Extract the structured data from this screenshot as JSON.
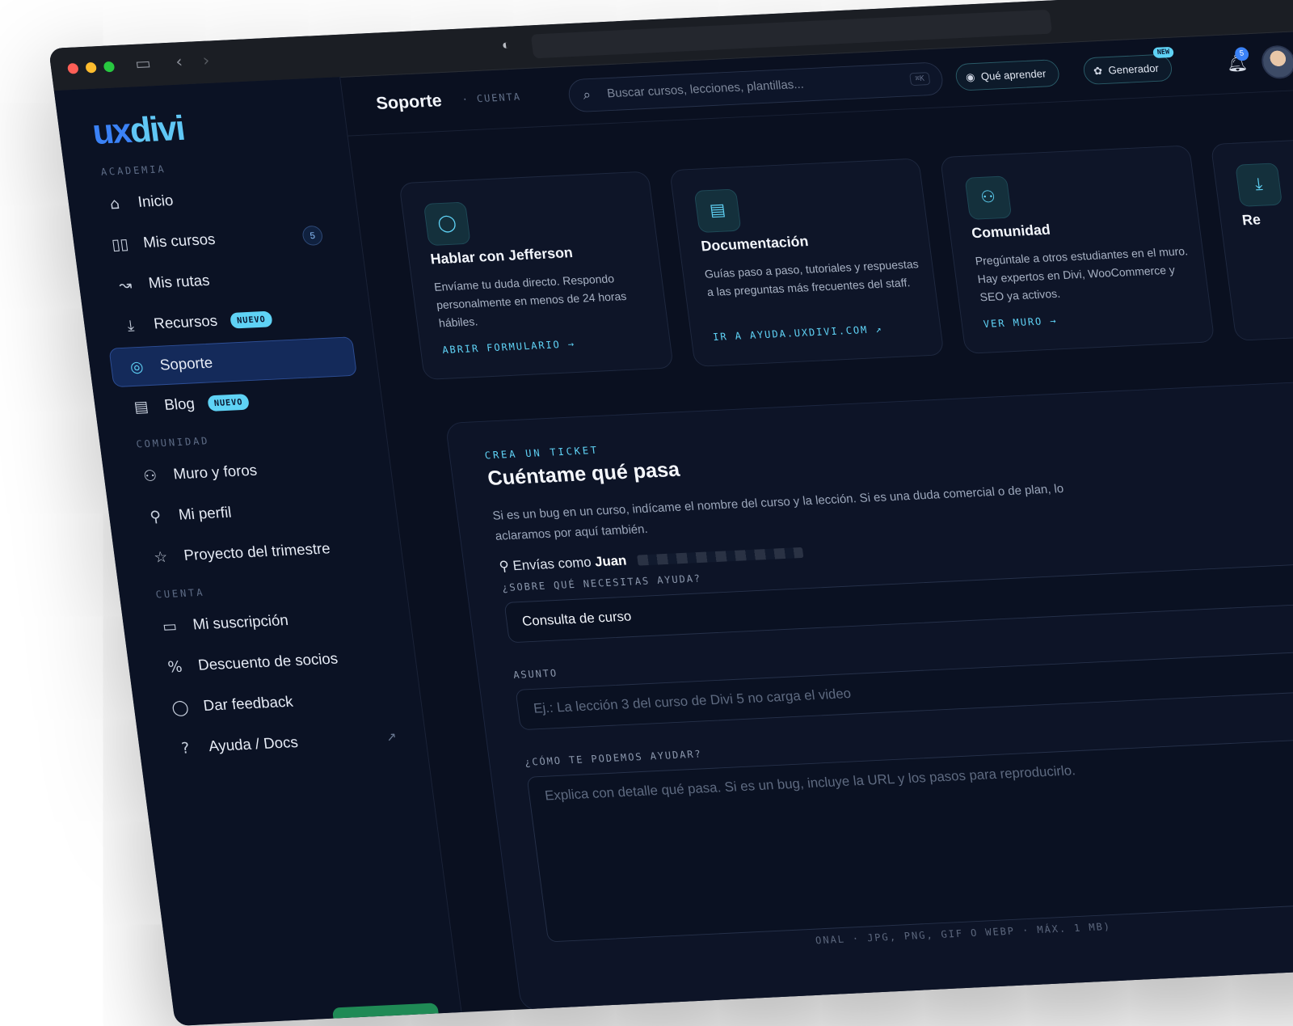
{
  "sidebar": {
    "logo": "uxdivi",
    "sections": {
      "academia": "ACADEMIA",
      "comunidad": "COMUNIDAD",
      "cuenta": "CUENTA"
    },
    "items": [
      {
        "label": "Inicio",
        "icon": "home-icon"
      },
      {
        "label": "Mis cursos",
        "icon": "book-icon",
        "count": "5"
      },
      {
        "label": "Mis rutas",
        "icon": "route-icon"
      },
      {
        "label": "Recursos",
        "icon": "download-icon",
        "badge": "NUEVO"
      },
      {
        "label": "Soporte",
        "icon": "lifebuoy-icon",
        "active": true
      },
      {
        "label": "Blog",
        "icon": "newspaper-icon",
        "badge": "NUEVO"
      },
      {
        "label": "Muro y foros",
        "icon": "users-icon"
      },
      {
        "label": "Mi perfil",
        "icon": "user-icon"
      },
      {
        "label": "Proyecto del trimestre",
        "icon": "star-icon"
      },
      {
        "label": "Mi suscripción",
        "icon": "credit-card-icon"
      },
      {
        "label": "Descuento de socios",
        "icon": "percent-icon"
      },
      {
        "label": "Dar feedback",
        "icon": "chat-icon"
      },
      {
        "label": "Ayuda / Docs",
        "icon": "help-icon",
        "external": true
      }
    ]
  },
  "topbar": {
    "title": "Soporte",
    "crumb": "· CUENTA",
    "search_placeholder": "Buscar cursos, lecciones, plantillas...",
    "search_kbd": "⌘K",
    "learn_label": "Qué aprender",
    "generator_label": "Generador",
    "generator_badge": "NEW",
    "notifications": "5"
  },
  "cards": [
    {
      "title": "Hablar con Jefferson",
      "text": "Envíame tu duda directo. Respondo personalmente en menos de 24 horas hábiles.",
      "link": "ABRIR FORMULARIO →",
      "icon": "chat-icon"
    },
    {
      "title": "Documentación",
      "text": "Guías paso a paso, tutoriales y respuestas a las preguntas más frecuentes del staff.",
      "link": "IR A AYUDA.UXDIVI.COM ↗",
      "icon": "document-icon"
    },
    {
      "title": "Comunidad",
      "text": "Pregúntale a otros estudiantes en el muro. Hay expertos en Divi, WooCommerce y SEO ya activos.",
      "link": "VER MURO →",
      "icon": "users-icon"
    },
    {
      "title": "Re",
      "text": "",
      "link": "",
      "icon": "download-icon"
    }
  ],
  "form": {
    "eyebrow": "CREA UN TICKET",
    "title": "Cuéntame qué pasa",
    "description": "Si es un bug en un curso, indícame el nombre del curso y la lección. Si es una duda comercial o de plan, lo aclaramos por aquí también.",
    "sender_prefix": "Envías como",
    "sender_name": "Juan",
    "topic_label": "¿SOBRE QUÉ NECESITAS AYUDA?",
    "topic_value": "Consulta de curso",
    "subject_label": "ASUNTO",
    "subject_placeholder": "Ej.: La lección 3 del curso de Divi 5 no carga el video",
    "body_label": "¿CÓMO TE PODEMOS AYUDAR?",
    "body_placeholder": "Explica con detalle qué pasa. Si es un bug, incluye la URL y los pasos para reproducirlo.",
    "attach_hint": "ONAL · JPG, PNG, GIF O WEBP · MÁX. 1 MB)"
  }
}
